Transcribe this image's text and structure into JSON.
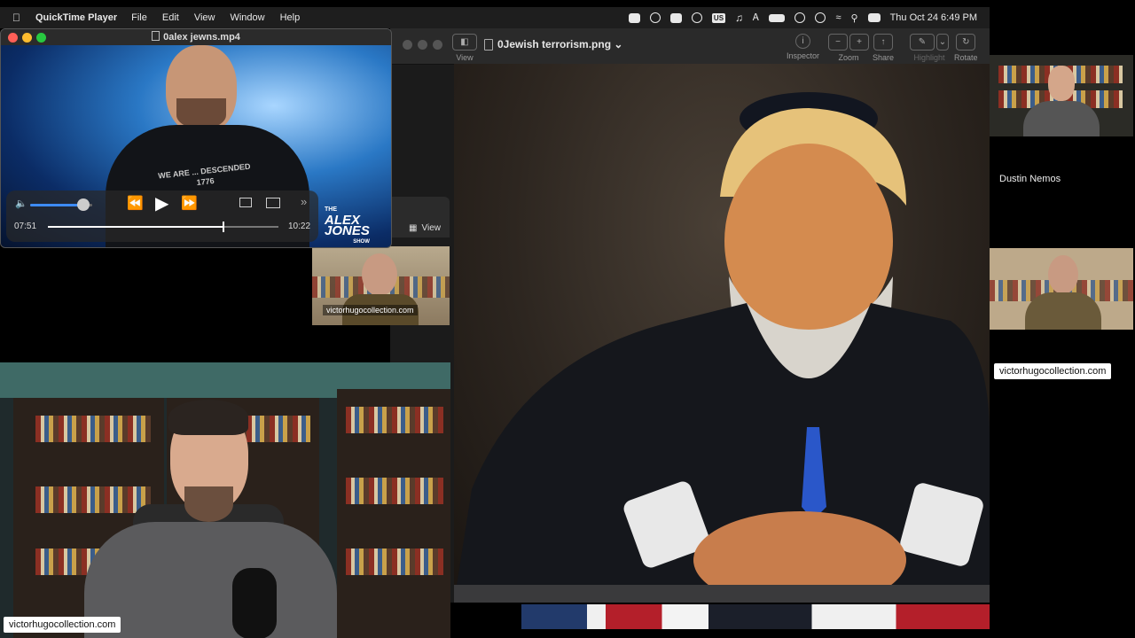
{
  "menubar": {
    "app_name": "QuickTime Player",
    "items": [
      "File",
      "Edit",
      "View",
      "Window",
      "Help"
    ],
    "datetime": "Thu Oct 24  6:49 PM",
    "language": "US"
  },
  "quicktime": {
    "title": "0alex jewns.mp4",
    "elapsed": "07:51",
    "duration": "10:22",
    "progress": 0.76,
    "volume": 0.85,
    "show_logo": [
      "THE",
      "ALEX",
      "JONES",
      "SHOW"
    ],
    "shirt_text": "WE ARE ... DESCENDED 1776"
  },
  "preview": {
    "title": "0Jewish terrorism.png",
    "toolbar": {
      "view_label": "View",
      "inspector_label": "Inspector",
      "zoom_label": "Zoom",
      "share_label": "Share",
      "highlight_label": "Highlight",
      "rotate_label": "Rotate"
    }
  },
  "mini_window": {
    "view_label": "View"
  },
  "participants": {
    "tile_caption_small": "victorhugocollection.com",
    "main_caption": "victorhugocollection.com",
    "right_name": "Dustin Nemos",
    "right_caption": "victorhugocollection.com"
  },
  "colors": {
    "menubar_bg": "#1e1e1e",
    "window_bg": "#2a2a2a",
    "close": "#ff5f57",
    "minimize": "#febc2e",
    "zoom": "#28c840"
  }
}
